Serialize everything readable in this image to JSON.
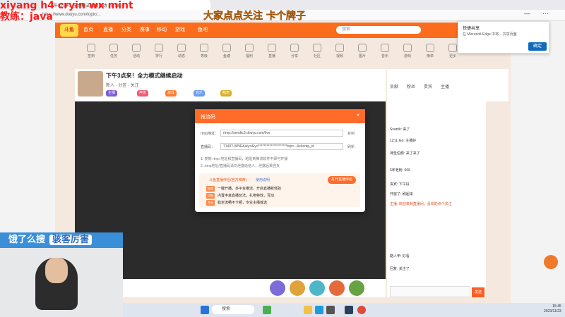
{
  "browser": {
    "tab_title": "下午3点来！全力模式继续启动 - 斗鱼",
    "url": "https://www.douyu.com/topic/...",
    "edge_popup": {
      "title": "快捷共享",
      "text": "在 Microsoft Edge 中将... 共享页面",
      "button": "确定"
    }
  },
  "overlay_text": {
    "red_line1": "xiyang h4 cryin wx mint",
    "red_line2": "教练：java",
    "yellow": "大家点点关注 卡个牌子",
    "blue_banner_left": "饿了么搜",
    "blue_banner_right": "骇客厉害"
  },
  "site_nav": {
    "logo": "斗鱼",
    "items": [
      "首页",
      "直播",
      "分类",
      "赛事",
      "移动",
      "游戏",
      "鱼吧"
    ],
    "search_placeholder": "搜索"
  },
  "categories": [
    "签到",
    "任务",
    "活动",
    "排行",
    "动态",
    "等级",
    "鱼塘",
    "福利",
    "直播",
    "分享",
    "社区",
    "视频",
    "图片",
    "音乐",
    "游戏",
    "榜单",
    "更多"
  ],
  "room": {
    "title": "下午3点来！全力模式继续启动",
    "meta": "新人 · 分区 · 关注",
    "tags": [
      "主播",
      "声优",
      "游戏",
      "音乐",
      "萌宠"
    ]
  },
  "modal": {
    "title": "推流码",
    "label_addr": "rtmp地址：",
    "addr_value": "rtmp://sendtc3.douyu.com/live",
    "label_code": "直播码：",
    "code_value": "7140?-WNE&aly=&ly=*********************tsp=...&clientp_id",
    "copy": "复制",
    "refresh": "刷新",
    "note1": "1. 复制 rtmp 地址和直播码，粘贴到推流软件中即可开播",
    "note2": "2. rtmp地址/直播码请勿泄露给他人，泄露后果自负",
    "notice_title": "斗鱼直播伴侣(官方推荐)",
    "notice_link": "使用说明",
    "open_button": "打开直播伴侣",
    "rows": [
      {
        "badge": "推荐",
        "text": "一键开播，多平台推流，开启直播新体验"
      },
      {
        "badge": "功能",
        "text": "内置丰富直播玩法，礼物特效，互动"
      },
      {
        "badge": "专业",
        "text": "稳定流畅不卡顿，专业主播首选"
      }
    ]
  },
  "chat": {
    "tabs": [
      "贡献",
      "粉丝",
      "贵宾",
      "主播"
    ],
    "lines": [
      "Svarrilt: 来了",
      "LZ1L.Go: 主播好",
      "神圣伯爵: 来了来了",
      "6年老粉: 666",
      "贵宾: 下午好",
      "开窗了: 刷起来",
      "主播: 欢迎来到直播间，喜欢的点个关注",
      "路人甲: 好看",
      "回复: 关注了"
    ],
    "send_label": "发送"
  },
  "taskbar": {
    "search": "搜索",
    "time": "15:45",
    "date": "2023/11/23"
  }
}
